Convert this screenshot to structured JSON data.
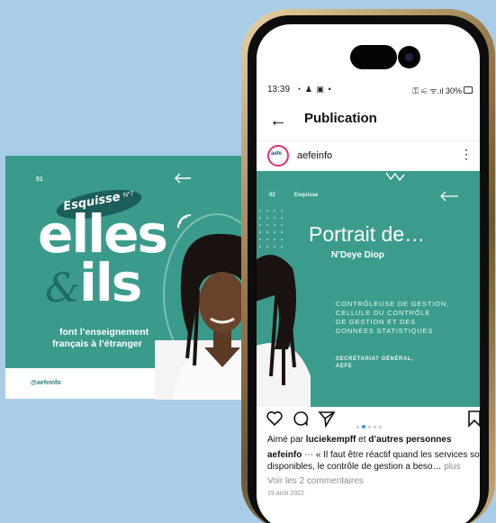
{
  "colors": {
    "background": "#a9cde8",
    "teal": "#3a9b8c",
    "dark_teal": "#1b5e5a",
    "accent_pink": "#e1306c",
    "link_blue": "#3897f0"
  },
  "slide": {
    "number": "01",
    "badge_word": "Esquisse",
    "badge_no": "N°7",
    "title_line1": "elles",
    "ampersand": "&",
    "title_line2": "ils",
    "tagline_line1": "font l’enseignement",
    "tagline_line2": "français à l’étranger",
    "footer_handle": "@aefeinfo",
    "back_icon": "arrow-left-icon"
  },
  "status_bar": {
    "time": "13:39",
    "left_icons": "◔ ♟ ▣ •",
    "right_text": "⚿ ⚟ ᯤ.ıl 30%"
  },
  "header": {
    "back_icon": "arrow-left-icon",
    "title": "Publication"
  },
  "account": {
    "avatar_text": "aefe",
    "username": "aefeinfo",
    "more_icon": "⋮"
  },
  "post": {
    "number": "02",
    "kicker": "Esquisse",
    "title": "Portrait de…",
    "name": "N’Deye Diop",
    "role_lines": [
      "CONTRÔLEUSE DE GESTION,",
      "CELLULE DU CONTRÔLE",
      "DE GESTION ET DES",
      "DONNÉES STATISTIQUES"
    ],
    "dept_line1": "SECRÉTARIAT GÉNÉRAL,",
    "dept_line2": "AEFE",
    "carousel_pages": 5,
    "carousel_active": 2
  },
  "actions": {
    "like_icon": "heart-icon",
    "comment_icon": "comment-icon",
    "share_icon": "send-icon",
    "save_icon": "bookmark-icon"
  },
  "likes": {
    "prefix": "Aimé par ",
    "user": "luciekempff",
    "middle": " et ",
    "others": "d’autres personnes"
  },
  "caption": {
    "user": "aefeinfo",
    "text": " ⋯ « Il faut être réactif quand les services sont disponibles, le contrôle de gestion a beso… ",
    "more": "plus"
  },
  "comments_link": "Voir les 2 commentaires",
  "date": "19 août 2022"
}
